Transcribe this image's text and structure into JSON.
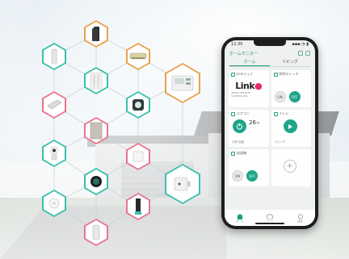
{
  "colors": {
    "teal": "#3bbfae",
    "pink": "#e8748f",
    "orange": "#e8a24a",
    "green": "#1ea58a"
  },
  "devices": [
    {
      "name": "router",
      "color": "orange"
    },
    {
      "name": "sensor-bar",
      "color": "teal"
    },
    {
      "name": "air-conditioner",
      "color": "orange"
    },
    {
      "name": "wall-switch",
      "color": "teal"
    },
    {
      "name": "thermostat",
      "color": "orange"
    },
    {
      "name": "air-purifier",
      "color": "pink"
    },
    {
      "name": "thermostat-round",
      "color": "teal"
    },
    {
      "name": "door-panel",
      "color": "pink"
    },
    {
      "name": "camera",
      "color": "teal"
    },
    {
      "name": "smart-speaker",
      "color": "teal"
    },
    {
      "name": "light-switch",
      "color": "pink"
    },
    {
      "name": "door-lock",
      "color": "teal"
    },
    {
      "name": "motion-sensor",
      "color": "teal"
    },
    {
      "name": "hub",
      "color": "pink"
    },
    {
      "name": "tower-speaker",
      "color": "pink"
    }
  ],
  "phone": {
    "status_time": "12:30",
    "status_icons": "▪▪▪ ◔ ▮",
    "app_title": "ホームモニター",
    "tabs": [
      {
        "label": "ホーム"
      },
      {
        "label": "リビング"
      }
    ],
    "cards": {
      "logo": {
        "label": "Linkジェイ",
        "brand_main": "Link",
        "brand_dot": "●",
        "brand_sub": "SMART REMOTE CONTROLLER"
      },
      "light": {
        "label": "照明スイッチ",
        "on": "ON",
        "off": "OFF"
      },
      "aircon": {
        "label": "エアコン",
        "temp": "26",
        "unit": "℃",
        "sub": "冷房 自動"
      },
      "tv": {
        "label": "テレビ",
        "sub": "リビング"
      },
      "fan": {
        "label": "扇風機",
        "on": "ON",
        "off": "OFF"
      },
      "add": {
        "label": "",
        "plus": "+"
      }
    },
    "nav": [
      {
        "label": "ホーム"
      },
      {
        "label": "シーン"
      },
      {
        "label": "設定"
      }
    ]
  }
}
